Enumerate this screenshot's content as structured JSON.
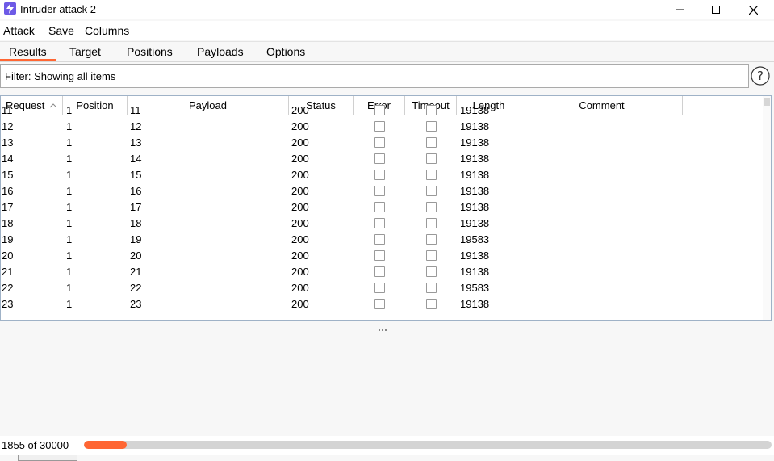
{
  "window": {
    "title": "Intruder attack 2"
  },
  "menu": [
    "Attack",
    "Save",
    "Columns"
  ],
  "tabs": [
    "Results",
    "Target",
    "Positions",
    "Payloads",
    "Options"
  ],
  "active_tab": "Results",
  "filter": {
    "text": "Filter: Showing all items"
  },
  "table": {
    "columns": [
      "Request",
      "Position",
      "Payload",
      "Status",
      "Error",
      "Timeout",
      "Length",
      "Comment"
    ],
    "sort_column": "Request",
    "sort_direction": "ascending",
    "rows": [
      {
        "request": "11",
        "position": "1",
        "payload": "11",
        "status": "200",
        "error": false,
        "timeout": false,
        "length": "19138",
        "comment": ""
      },
      {
        "request": "12",
        "position": "1",
        "payload": "12",
        "status": "200",
        "error": false,
        "timeout": false,
        "length": "19138",
        "comment": ""
      },
      {
        "request": "13",
        "position": "1",
        "payload": "13",
        "status": "200",
        "error": false,
        "timeout": false,
        "length": "19138",
        "comment": ""
      },
      {
        "request": "14",
        "position": "1",
        "payload": "14",
        "status": "200",
        "error": false,
        "timeout": false,
        "length": "19138",
        "comment": ""
      },
      {
        "request": "15",
        "position": "1",
        "payload": "15",
        "status": "200",
        "error": false,
        "timeout": false,
        "length": "19138",
        "comment": ""
      },
      {
        "request": "16",
        "position": "1",
        "payload": "16",
        "status": "200",
        "error": false,
        "timeout": false,
        "length": "19138",
        "comment": ""
      },
      {
        "request": "17",
        "position": "1",
        "payload": "17",
        "status": "200",
        "error": false,
        "timeout": false,
        "length": "19138",
        "comment": ""
      },
      {
        "request": "18",
        "position": "1",
        "payload": "18",
        "status": "200",
        "error": false,
        "timeout": false,
        "length": "19138",
        "comment": ""
      },
      {
        "request": "19",
        "position": "1",
        "payload": "19",
        "status": "200",
        "error": false,
        "timeout": false,
        "length": "19583",
        "comment": ""
      },
      {
        "request": "20",
        "position": "1",
        "payload": "20",
        "status": "200",
        "error": false,
        "timeout": false,
        "length": "19138",
        "comment": ""
      },
      {
        "request": "21",
        "position": "1",
        "payload": "21",
        "status": "200",
        "error": false,
        "timeout": false,
        "length": "19138",
        "comment": ""
      },
      {
        "request": "22",
        "position": "1",
        "payload": "22",
        "status": "200",
        "error": false,
        "timeout": false,
        "length": "19583",
        "comment": ""
      },
      {
        "request": "23",
        "position": "1",
        "payload": "23",
        "status": "200",
        "error": false,
        "timeout": false,
        "length": "19138",
        "comment": ""
      }
    ]
  },
  "progress": {
    "label": "1855 of 30000",
    "fraction": 0.0618
  },
  "colors": {
    "accent": "#ff6633",
    "app_icon": "#6d5ae6"
  },
  "icons": [
    "app-lightning-icon",
    "minimize-icon",
    "maximize-icon",
    "close-icon",
    "help-icon",
    "sort-ascending-icon"
  ]
}
